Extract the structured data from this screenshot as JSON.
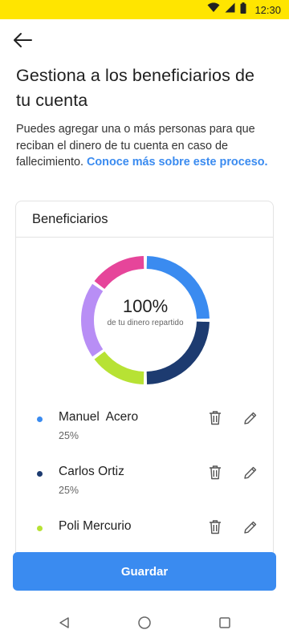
{
  "status_bar": {
    "time": "12:30",
    "background": "#ffe500",
    "icons": [
      "wifi-icon",
      "signal-icon",
      "battery-icon"
    ]
  },
  "header": {
    "back_icon": "arrow-left-icon",
    "title": "Gestiona a los beneficiarios de tu cuenta"
  },
  "intro": {
    "text": "Puedes agregar una o más personas para que reciban el dinero de tu cuenta en caso de fallecimiento.",
    "link": "Conoce más sobre este proceso."
  },
  "card": {
    "title": "Beneficiarios",
    "summary_value": "100%",
    "summary_caption": "de tu dinero repartido"
  },
  "chart_data": {
    "type": "pie",
    "donut": true,
    "slices": [
      {
        "label": "Manuel  Acero",
        "value": 25,
        "color": "#3a8bf0"
      },
      {
        "label": "Carlos Ortiz",
        "value": 25,
        "color": "#1d3b70"
      },
      {
        "label": "Poli Mercurio",
        "value": 15,
        "color": "#b7e234"
      },
      {
        "value": 20,
        "color": "#b88ef5"
      },
      {
        "value": 15,
        "color": "#e6459a"
      }
    ]
  },
  "beneficiaries": [
    {
      "name": "Manuel  Acero",
      "percent": "25%",
      "color": "#3a8bf0"
    },
    {
      "name": "Carlos Ortiz",
      "percent": "25%",
      "color": "#1d3b70"
    },
    {
      "name": "Poli Mercurio",
      "percent": "",
      "color": "#b7e234"
    }
  ],
  "actions": {
    "save_label": "Guardar",
    "accent": "#3a8bf0"
  },
  "nav": {
    "icons": [
      "back-triangle-icon",
      "home-circle-icon",
      "recents-square-icon"
    ]
  }
}
